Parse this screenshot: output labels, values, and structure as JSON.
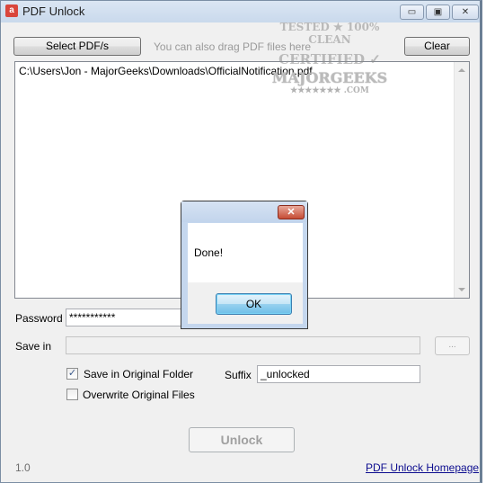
{
  "window": {
    "title": "PDF Unlock",
    "icon": "pdf-unlock-icon",
    "controls": {
      "minimize": "minimize-icon",
      "maximize": "maximize-icon",
      "close": "close-icon"
    },
    "control_glyphs": {
      "minimize": "▭",
      "maximize": "▣",
      "close": "✕"
    }
  },
  "toolbar": {
    "select_label": "Select PDF/s",
    "hint": "You can also drag PDF files here",
    "clear_label": "Clear"
  },
  "watermark": {
    "line1": "TESTED ★ 100% CLEAN",
    "line2": "CERTIFIED ✓",
    "line3": "MAJORGEEKS",
    "line4": "★★★★★★★ .COM"
  },
  "file_list": {
    "items": [
      "C:\\Users\\Jon - MajorGeeks\\Downloads\\OfficialNotification.pdf"
    ]
  },
  "form": {
    "password_label": "Password",
    "password_value": "***********",
    "savein_label": "Save in",
    "savein_value": "",
    "browse_label": "...",
    "save_original_label": "Save in Original Folder",
    "save_original_checked": true,
    "overwrite_label": "Overwrite Original Files",
    "overwrite_checked": false,
    "suffix_label": "Suffix",
    "suffix_value": "_unlocked",
    "checkmark": "✓"
  },
  "footer": {
    "unlock_label": "Unlock",
    "version": "1.0",
    "homepage_link": "PDF Unlock Homepage"
  },
  "dialog": {
    "close_glyph": "✕",
    "message": "Done!",
    "ok_label": "OK"
  }
}
